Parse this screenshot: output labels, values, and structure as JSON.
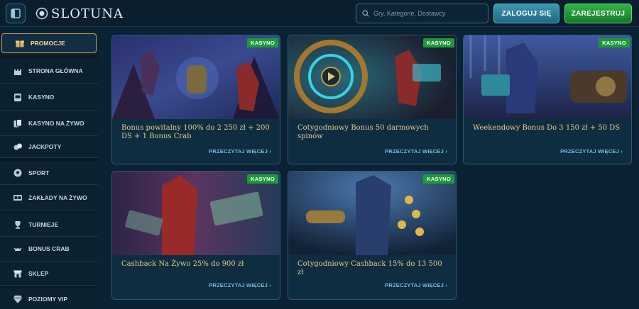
{
  "header": {
    "logo_text": "SLOTUNA",
    "search_placeholder": "Gry, Kategorie, Dostawcy",
    "login_label": "ZALOGUJ SIĘ",
    "register_label": "ZAREJESTRUJ"
  },
  "sidebar": {
    "items": [
      {
        "label": "PROMOCJE",
        "icon": "gift-icon",
        "active": true
      },
      {
        "label": "STRONA GŁÓWNA",
        "icon": "castle-icon"
      },
      {
        "label": "KASYNO",
        "icon": "slot-machine-icon"
      },
      {
        "label": "KASYNO NA ŻYWO",
        "icon": "cards-icon"
      },
      {
        "label": "JACKPOTY",
        "icon": "coins-icon"
      },
      {
        "label": "SPORT",
        "icon": "ball-icon"
      },
      {
        "label": "ZAKŁADY NA ŻYWO",
        "icon": "live-scoreboard-icon"
      },
      {
        "label": "TURNIEJE",
        "icon": "trophy-icon"
      },
      {
        "label": "BONUS CRAB",
        "icon": "crab-icon"
      },
      {
        "label": "SKLEP",
        "icon": "shop-icon"
      },
      {
        "label": "POZIOMY VIP",
        "icon": "diamond-icon"
      }
    ]
  },
  "promotions": [
    {
      "badge": "KASYNO",
      "title": "Bonus powitalny 100% do 2 250 zł + 200 DS + 1 Bonus Crab",
      "more": "PRZECZYTAJ WIĘCEJ ›"
    },
    {
      "badge": "KASYNO",
      "title": "Cotygodniowy Bonus 50 darmowych spinów",
      "more": "PRZECZYTAJ WIĘCEJ ›"
    },
    {
      "badge": "KASYNO",
      "title": "Weekendowy Bonus Do 3 150 zł + 50 DS",
      "more": "PRZECZYTAJ WIĘCEJ ›"
    },
    {
      "badge": "KASYNO",
      "title": "Cashback Na Żywo 25% do 900 zł",
      "more": "PRZECZYTAJ WIĘCEJ ›"
    },
    {
      "badge": "KASYNO",
      "title": "Cotygodniowy Cashback 15% do 13 500 zł",
      "more": "PRZECZYTAJ WIĘCEJ ›"
    }
  ],
  "colors": {
    "background": "#0a2233",
    "accent_gold": "#e0c98e",
    "link": "#6fc0de",
    "badge_green": "#1d9a3b",
    "login": "#2a809c",
    "register": "#23963a"
  }
}
